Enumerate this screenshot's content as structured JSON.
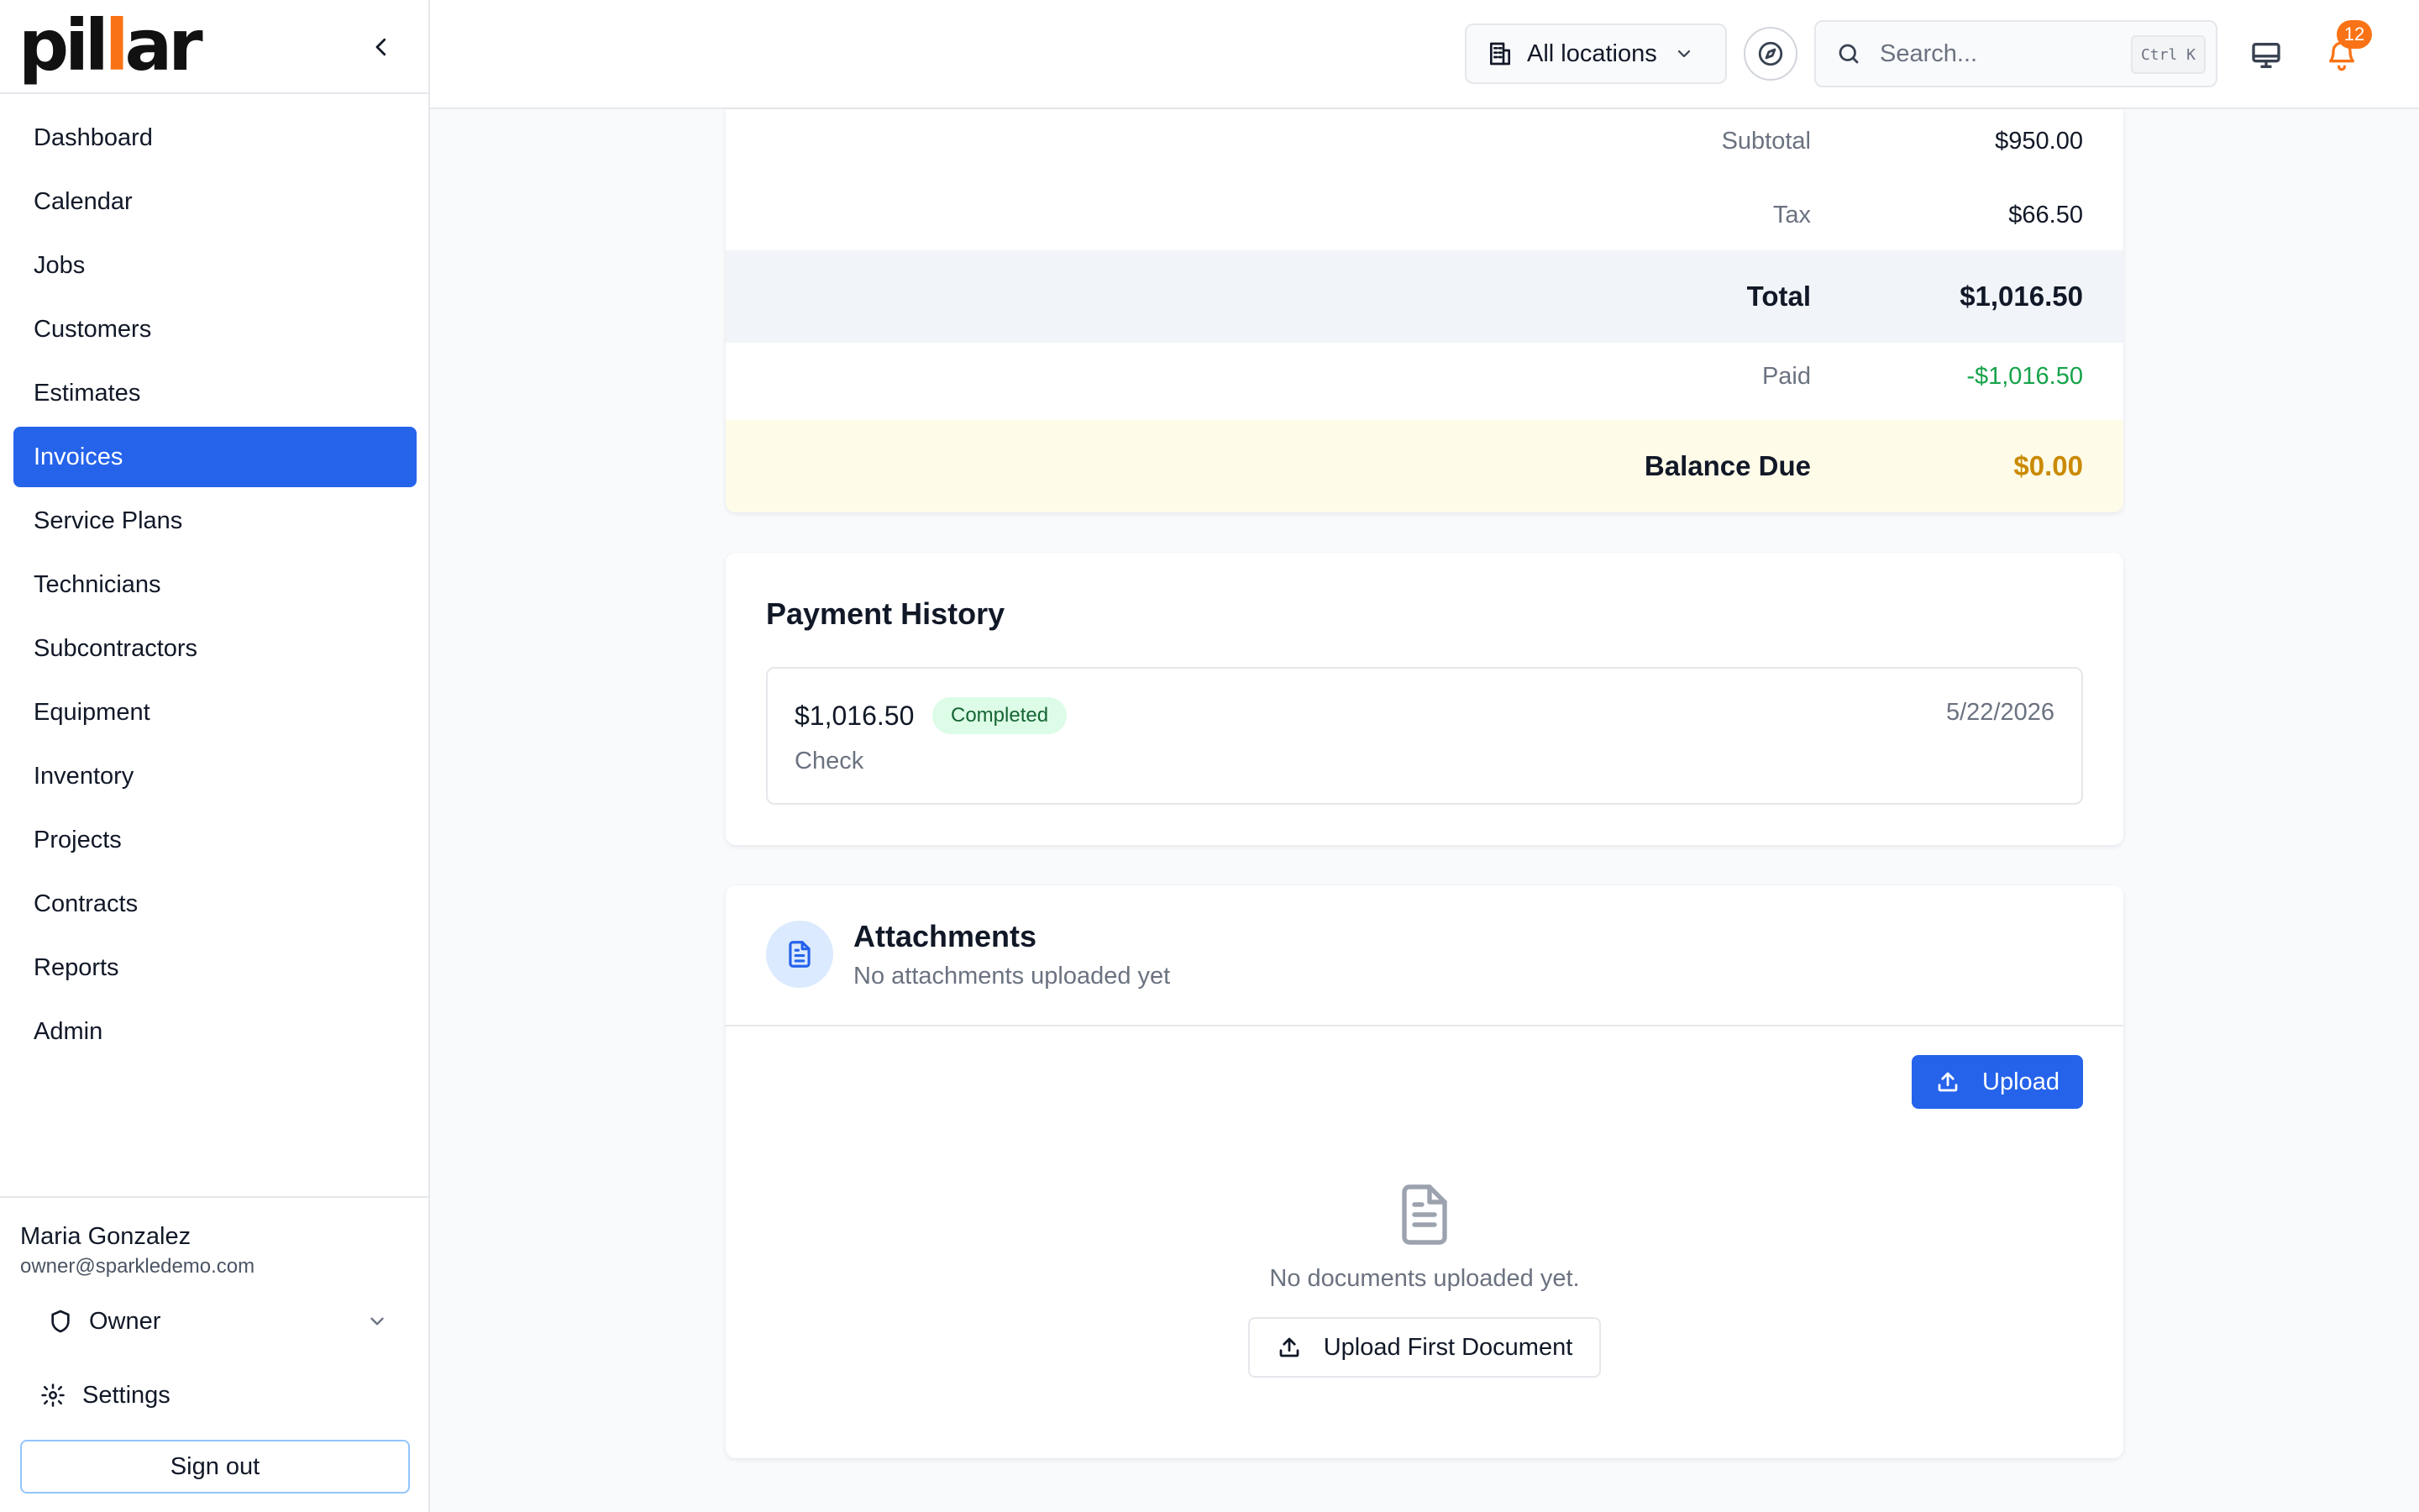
{
  "app": {
    "logo_text_1": "pil",
    "logo_text_2": "l",
    "logo_text_3": "ar"
  },
  "sidebar": {
    "items": [
      {
        "label": "Dashboard"
      },
      {
        "label": "Calendar"
      },
      {
        "label": "Jobs"
      },
      {
        "label": "Customers"
      },
      {
        "label": "Estimates"
      },
      {
        "label": "Invoices",
        "active": true
      },
      {
        "label": "Service Plans"
      },
      {
        "label": "Technicians"
      },
      {
        "label": "Subcontractors"
      },
      {
        "label": "Equipment"
      },
      {
        "label": "Inventory"
      },
      {
        "label": "Projects"
      },
      {
        "label": "Contracts"
      },
      {
        "label": "Reports"
      },
      {
        "label": "Admin"
      }
    ],
    "user": {
      "name": "Maria Gonzalez",
      "email": "owner@sparkledemo.com",
      "role": "Owner"
    },
    "settings_label": "Settings",
    "signout_label": "Sign out"
  },
  "topbar": {
    "location_label": "All locations",
    "search_placeholder": "Search...",
    "search_shortcut": "Ctrl K",
    "notification_count": "12"
  },
  "totals": {
    "subtotal_label": "Subtotal",
    "subtotal_value": "$950.00",
    "tax_label": "Tax",
    "tax_value": "$66.50",
    "total_label": "Total",
    "total_value": "$1,016.50",
    "paid_label": "Paid",
    "paid_value": "-$1,016.50",
    "balance_label": "Balance Due",
    "balance_value": "$0.00"
  },
  "payment_history": {
    "title": "Payment History",
    "items": [
      {
        "amount": "$1,016.50",
        "status": "Completed",
        "method": "Check",
        "date": "5/22/2026"
      }
    ]
  },
  "attachments": {
    "title": "Attachments",
    "subtitle": "No attachments uploaded yet",
    "upload_label": "Upload",
    "empty_text": "No documents uploaded yet.",
    "upload_first_label": "Upload First Document"
  },
  "colors": {
    "primary": "#2563eb",
    "accent": "#f97316",
    "success": "#16a34a",
    "balance": "#ca8a04",
    "total_row_bg": "#f1f5f9",
    "balance_row_bg": "#fefce8"
  }
}
